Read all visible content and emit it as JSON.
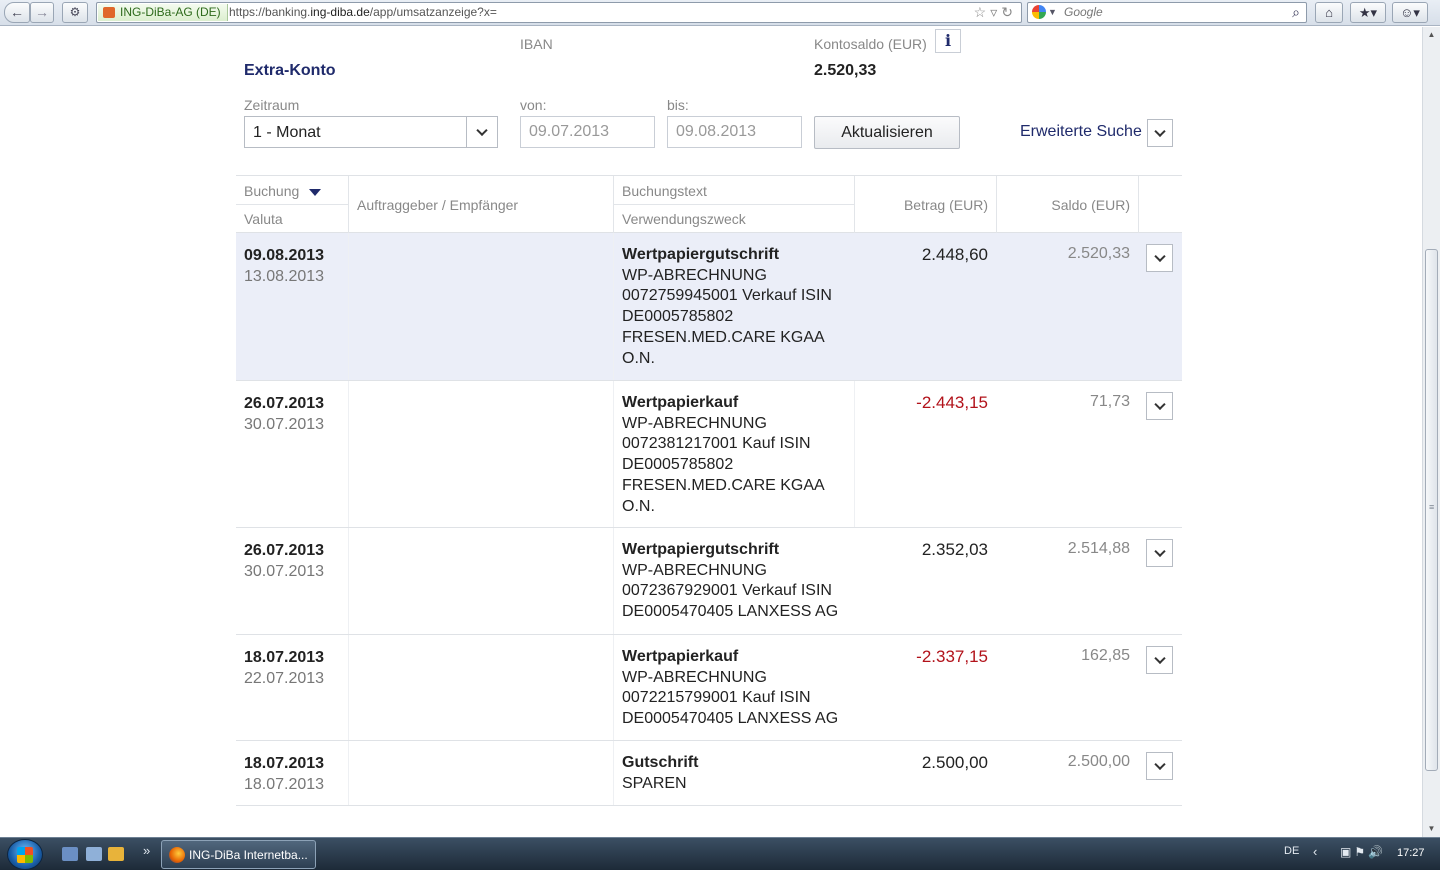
{
  "browser": {
    "site_identity": "ING-DiBa-AG (DE)",
    "url_prefix": "https://banking.",
    "url_domain": "ing-diba.de",
    "url_path": "/app/umsatzanzeige?x=",
    "search_placeholder": "Google"
  },
  "account": {
    "name": "Extra-Konto",
    "iban_label": "IBAN",
    "balance_label": "Kontosaldo (EUR)",
    "balance": "2.520,33"
  },
  "filters": {
    "period_label": "Zeitraum",
    "period_value": "1 - Monat",
    "from_label": "von:",
    "from_value": "09.07.2013",
    "to_label": "bis:",
    "to_value": "09.08.2013",
    "update_label": "Aktualisieren",
    "advanced_label": "Erweiterte Suche"
  },
  "table": {
    "headers": {
      "booking": "Buchung",
      "valuta": "Valuta",
      "counterparty": "Auftraggeber / Empfänger",
      "booking_text": "Buchungstext",
      "purpose": "Verwendungszweck",
      "amount": "Betrag (EUR)",
      "saldo": "Saldo (EUR)"
    },
    "rows": [
      {
        "booking_date": "09.08.2013",
        "valuta_date": "13.08.2013",
        "title": "Wertpapiergutschrift",
        "lines": [
          "WP-ABRECHNUNG",
          "0072759945001 Verkauf ISIN",
          "DE0005785802",
          "FRESEN.MED.CARE KGAA",
          "O.N."
        ],
        "amount": "2.448,60",
        "saldo": "2.520,33"
      },
      {
        "booking_date": "26.07.2013",
        "valuta_date": "30.07.2013",
        "title": "Wertpapierkauf",
        "lines": [
          "WP-ABRECHNUNG",
          "0072381217001 Kauf ISIN",
          "DE0005785802",
          "FRESEN.MED.CARE KGAA",
          "O.N."
        ],
        "amount": "-2.443,15",
        "saldo": "71,73"
      },
      {
        "booking_date": "26.07.2013",
        "valuta_date": "30.07.2013",
        "title": "Wertpapiergutschrift",
        "lines": [
          "WP-ABRECHNUNG",
          "0072367929001 Verkauf ISIN",
          "DE0005470405 LANXESS AG"
        ],
        "amount": "2.352,03",
        "saldo": "2.514,88"
      },
      {
        "booking_date": "18.07.2013",
        "valuta_date": "22.07.2013",
        "title": "Wertpapierkauf",
        "lines": [
          "WP-ABRECHNUNG",
          "0072215799001 Kauf ISIN",
          "DE0005470405 LANXESS AG"
        ],
        "amount": "-2.337,15",
        "saldo": "162,85"
      },
      {
        "booking_date": "18.07.2013",
        "valuta_date": "18.07.2013",
        "title": "Gutschrift",
        "lines": [
          "SPAREN"
        ],
        "amount": "2.500,00",
        "saldo": "2.500,00"
      }
    ]
  },
  "taskbar": {
    "task_label": "ING-DiBa Internetba...",
    "language": "DE",
    "clock": "17:27"
  },
  "colors": {
    "brand_navy": "#1f2a6b",
    "negative_amount": "#b2121a",
    "highlight_row": "#ebeef8"
  }
}
